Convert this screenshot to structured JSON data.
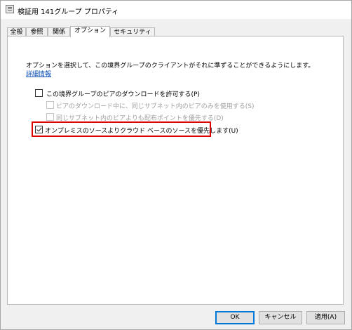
{
  "window": {
    "title": "検証用 141グループ プロパティ",
    "icon": "window-properties-icon"
  },
  "tabs": [
    {
      "label": "全般",
      "active": false
    },
    {
      "label": "参照",
      "active": false
    },
    {
      "label": "関係",
      "active": false
    },
    {
      "label": "オプション",
      "active": true
    },
    {
      "label": "セキュリティ",
      "active": false
    }
  ],
  "options": {
    "description": "オプションを選択して、この境界グループのクライアントがそれに準ずることができるようにします。",
    "details_link": "詳細情報",
    "checkboxes": [
      {
        "label": "この境界グループのピアのダウンロードを許可する(P)",
        "checked": false,
        "enabled": true
      },
      {
        "label": "ピアのダウンロード中に、同じサブネット内のピアのみを使用する(S)",
        "checked": false,
        "enabled": false
      },
      {
        "label": "同じサブネット内のピアよりも配布ポイントを優先する(D)",
        "checked": false,
        "enabled": false
      },
      {
        "label": "オンプレミスのソースよりクラウド ベースのソースを優先します(U)",
        "checked": true,
        "enabled": true,
        "highlighted": true
      }
    ]
  },
  "buttons": {
    "ok": "OK",
    "cancel": "キャンセル",
    "apply": "適用(A)"
  },
  "colors": {
    "highlight_border": "#e00000",
    "link": "#0b4fb5",
    "default_button_border": "#0078d7"
  }
}
